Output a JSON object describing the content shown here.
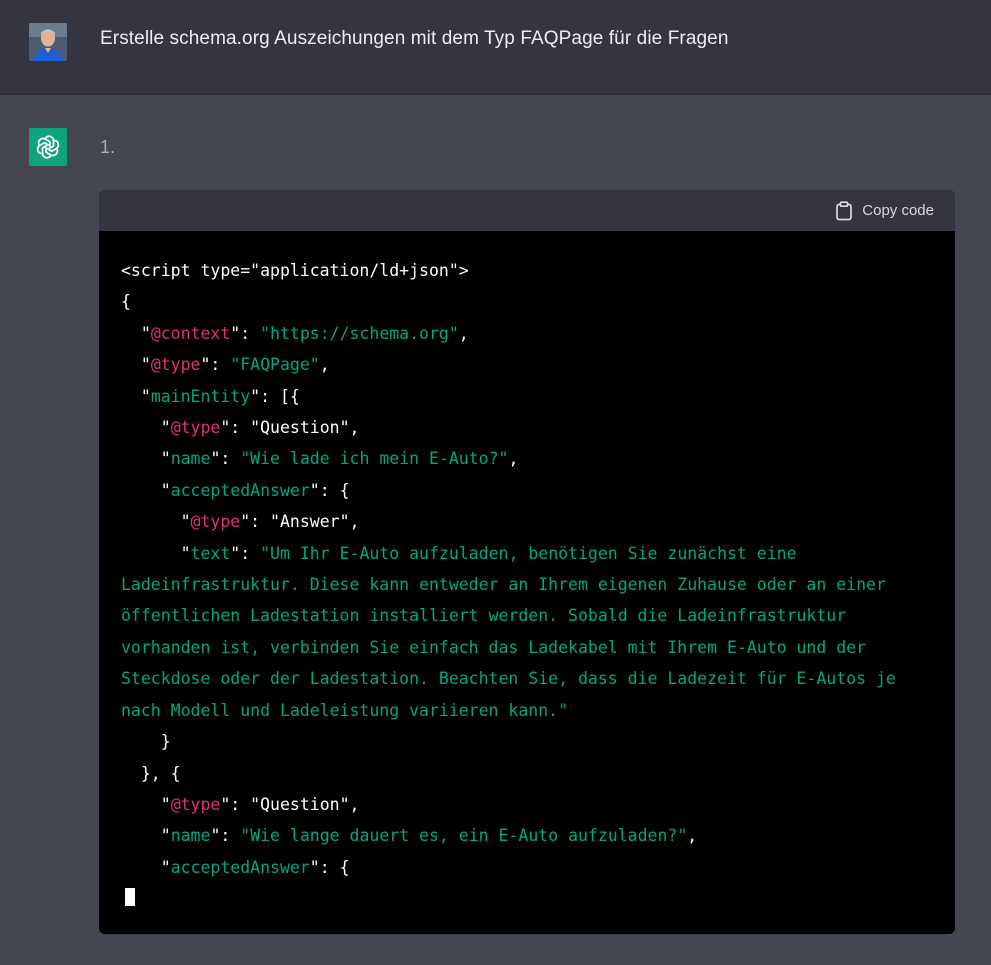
{
  "user_message": {
    "text": "Erstelle schema.org Auszeichungen mit dem Typ FAQPage für die Fragen"
  },
  "assistant_message": {
    "list_marker": "1.",
    "code_block": {
      "copy_label": "Copy code",
      "lines": [
        "<script type=\"application/ld+json\">",
        "{",
        "  \"@context\": \"https://schema.org\",",
        "  \"@type\": \"FAQPage\",",
        "  \"mainEntity\": [{",
        "    \"@type\": \"Question\",",
        "    \"name\": \"Wie lade ich mein E-Auto?\",",
        "    \"acceptedAnswer\": {",
        "      \"@type\": \"Answer\",",
        "      \"text\": \"Um Ihr E-Auto aufzuladen, benötigen Sie zunächst eine",
        "Ladeinfrastruktur. Diese kann entweder an Ihrem eigenen Zuhause oder an einer",
        "öffentlichen Ladestation installiert werden. Sobald die Ladeinfrastruktur",
        "vorhanden ist, verbinden Sie einfach das Ladekabel mit Ihrem E-Auto und der",
        "Steckdose oder der Ladestation. Beachten Sie, dass die Ladezeit für E-Autos je",
        "nach Modell und Ladeleistung variieren kann.\"",
        "    }",
        "  }, {",
        "    \"@type\": \"Question\",",
        "    \"name\": \"Wie lange dauert es, ein E-Auto aufzuladen?\",",
        "    \"acceptedAnswer\": {"
      ]
    }
  },
  "colors": {
    "user_bg": "#343541",
    "assistant_bg": "#444654",
    "code_bg": "#000000",
    "token_key": "#df3079",
    "token_string": "#00a67d",
    "openai_green": "#10a37f"
  }
}
